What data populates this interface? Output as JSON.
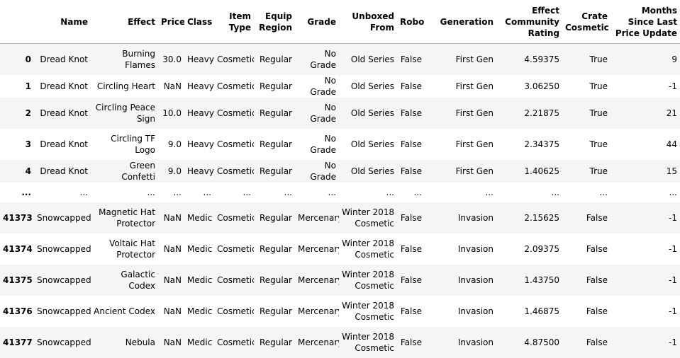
{
  "columns": [
    "",
    "Name",
    "Effect",
    "Price",
    "Class",
    "Item Type",
    "Equip Region",
    "Grade",
    "Unboxed From",
    "Robo",
    "Generation",
    "Effect Community Rating",
    "Crate Cosmetic",
    "Months Since Last Price Update"
  ],
  "rows": [
    {
      "index": "0",
      "cells": [
        "Dread Knot",
        "Burning Flames",
        "30.0",
        "Heavy",
        "Cosmetic",
        "Regular",
        "No Grade",
        "Old Series",
        "False",
        "First Gen",
        "4.59375",
        "True",
        "9"
      ]
    },
    {
      "index": "1",
      "cells": [
        "Dread Knot",
        "Circling Heart",
        "NaN",
        "Heavy",
        "Cosmetic",
        "Regular",
        "No Grade",
        "Old Series",
        "False",
        "First Gen",
        "3.06250",
        "True",
        "-1"
      ]
    },
    {
      "index": "2",
      "cells": [
        "Dread Knot",
        "Circling Peace Sign",
        "10.0",
        "Heavy",
        "Cosmetic",
        "Regular",
        "No Grade",
        "Old Series",
        "False",
        "First Gen",
        "2.21875",
        "True",
        "21"
      ]
    },
    {
      "index": "3",
      "cells": [
        "Dread Knot",
        "Circling TF Logo",
        "9.0",
        "Heavy",
        "Cosmetic",
        "Regular",
        "No Grade",
        "Old Series",
        "False",
        "First Gen",
        "2.34375",
        "True",
        "44"
      ]
    },
    {
      "index": "4",
      "cells": [
        "Dread Knot",
        "Green Confetti",
        "9.0",
        "Heavy",
        "Cosmetic",
        "Regular",
        "No Grade",
        "Old Series",
        "False",
        "First Gen",
        "1.40625",
        "True",
        "15"
      ]
    },
    {
      "index": "...",
      "cells": [
        "...",
        "...",
        "...",
        "...",
        "...",
        "...",
        "...",
        "...",
        "...",
        "...",
        "...",
        "...",
        "..."
      ]
    },
    {
      "index": "41373",
      "cells": [
        "Snowcapped",
        "Magnetic Hat Protector",
        "NaN",
        "Medic",
        "Cosmetic",
        "Regular",
        "Mercenary",
        "Winter 2018 Cosmetic",
        "False",
        "Invasion",
        "2.15625",
        "False",
        "-1"
      ]
    },
    {
      "index": "41374",
      "cells": [
        "Snowcapped",
        "Voltaic Hat Protector",
        "NaN",
        "Medic",
        "Cosmetic",
        "Regular",
        "Mercenary",
        "Winter 2018 Cosmetic",
        "False",
        "Invasion",
        "2.09375",
        "False",
        "-1"
      ]
    },
    {
      "index": "41375",
      "cells": [
        "Snowcapped",
        "Galactic Codex",
        "NaN",
        "Medic",
        "Cosmetic",
        "Regular",
        "Mercenary",
        "Winter 2018 Cosmetic",
        "False",
        "Invasion",
        "1.43750",
        "False",
        "-1"
      ]
    },
    {
      "index": "41376",
      "cells": [
        "Snowcapped",
        "Ancient Codex",
        "NaN",
        "Medic",
        "Cosmetic",
        "Regular",
        "Mercenary",
        "Winter 2018 Cosmetic",
        "False",
        "Invasion",
        "1.46875",
        "False",
        "-1"
      ]
    },
    {
      "index": "41377",
      "cells": [
        "Snowcapped",
        "Nebula",
        "NaN",
        "Medic",
        "Cosmetic",
        "Regular",
        "Mercenary",
        "Winter 2018 Cosmetic",
        "False",
        "Invasion",
        "4.87500",
        "False",
        "-1"
      ]
    }
  ]
}
